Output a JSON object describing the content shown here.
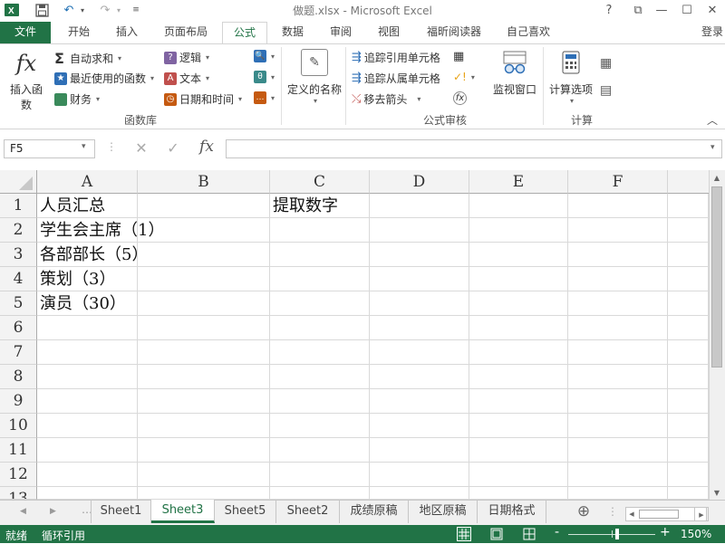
{
  "titlebar": {
    "title": "做题.xlsx - Microsoft Excel",
    "help": "?",
    "ribbon_display": "⧉",
    "minimize": "—",
    "restore": "☐",
    "close": "✕"
  },
  "tabs": {
    "file": "文件",
    "items": [
      "开始",
      "插入",
      "页面布局",
      "公式",
      "数据",
      "审阅",
      "视图",
      "福昕阅读器",
      "自己喜欢"
    ],
    "active": "公式",
    "signin": "登录"
  },
  "ribbon": {
    "insert_function": "插入函数",
    "autosum": "自动求和",
    "recently_used": "最近使用的函数",
    "financial": "财务",
    "logical": "逻辑",
    "text": "文本",
    "date_time": "日期和时间",
    "function_library_label": "函数库",
    "define_name": "定义的名称",
    "trace_precedents": "追踪引用单元格",
    "trace_dependents": "追踪从属单元格",
    "remove_arrows": "移去箭头",
    "watch_window": "监视窗口",
    "formula_auditing_label": "公式审核",
    "calc_options": "计算选项",
    "calculation_label": "计算"
  },
  "formula_bar": {
    "name_box": "F5",
    "cancel": "✕",
    "enter": "✓",
    "fx": "fx",
    "value": ""
  },
  "sheet": {
    "columns": [
      "A",
      "B",
      "C",
      "D",
      "E",
      "F"
    ],
    "rows": [
      "1",
      "2",
      "3",
      "4",
      "5",
      "6",
      "7",
      "8",
      "9",
      "10",
      "11",
      "12",
      "13"
    ],
    "cells": {
      "A1": "人员汇总",
      "C1": "提取数字",
      "A2": "学生会主席（1）",
      "A3": "各部部长（5）",
      "A4": "策划（3）",
      "A5": "演员（30）"
    }
  },
  "sheet_tabs": {
    "items": [
      "Sheet1",
      "Sheet3",
      "Sheet5",
      "Sheet2",
      "成绩原稿",
      "地区原稿",
      "日期格式"
    ],
    "active": "Sheet3",
    "add": "⊕"
  },
  "status": {
    "ready": "就绪",
    "circular": "循环引用",
    "zoom_out": "-",
    "zoom_in": "+",
    "zoom": "150%",
    "zoom_level": 0.5
  },
  "colors": {
    "accent": "#217346",
    "header_bg": "#f3f3f3",
    "grid_line": "#d9d9d9"
  }
}
